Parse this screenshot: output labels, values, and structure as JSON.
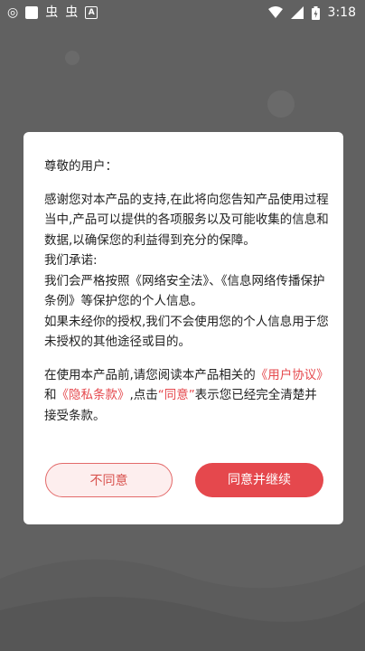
{
  "status_bar": {
    "time": "3:18",
    "left_icons": [
      "notification-icon",
      "square-icon",
      "bug-icon",
      "bug-icon",
      "a-icon"
    ],
    "right_icons": [
      "wifi-icon",
      "signal-icon",
      "battery-icon"
    ]
  },
  "dialog": {
    "greeting": "尊敬的用户：",
    "para1": "感谢您对本产品的支持,在此将向您告知产品使用过程当中,产品可以提供的各项服务以及可能收集的信息和数据,以确保您的利益得到充分的保障。",
    "promise_title": "我们承诺:",
    "promise1": "我们会严格按照《网络安全法》、《信息网络传播保护条例》等保护您的个人信息。",
    "promise2": "如果未经你的授权,我们不会使用您的个人信息用于您未授权的其他途径或目的。",
    "agreement": {
      "text1": "在使用本产品前,请您阅读本产品相关的",
      "link_user": "《用户协议》",
      "text2": "和",
      "link_privacy": "《隐私条款》",
      "text3": ",点击",
      "link_agree": "“同意”",
      "text4": "表示您已经完全清楚并接受条款。"
    },
    "decline_label": "不同意",
    "accept_label": "同意并继续"
  },
  "colors": {
    "accent": "#e5484d",
    "overlay": "#616161"
  }
}
